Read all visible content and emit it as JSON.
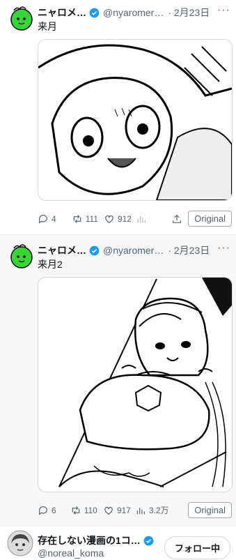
{
  "tweet1": {
    "author_name": "ニャロメ…",
    "handle": "@nyaromer…",
    "date": "· 2月23日",
    "more_label": "···",
    "text": "来月",
    "stats": {
      "replies": "4",
      "retweets": "111",
      "likes": "912",
      "views": ""
    },
    "original_label": "Original"
  },
  "tweet2": {
    "author_name": "ニャロメ…",
    "handle": "@nyaromer…",
    "date": "· 2月23日",
    "more_label": "···",
    "text": "来月2",
    "stats": {
      "replies": "6",
      "retweets": "110",
      "likes": "917",
      "views": "3.2万"
    },
    "original_label": "Original"
  },
  "recommend": {
    "name": "存在しない漫画の1コ…",
    "handle": "@noreal_koma",
    "follow_label": "フォロー中"
  },
  "colors": {
    "verified": "#1d9bf0",
    "avatar_green": "#37d536",
    "secondary_text": "#536471"
  }
}
